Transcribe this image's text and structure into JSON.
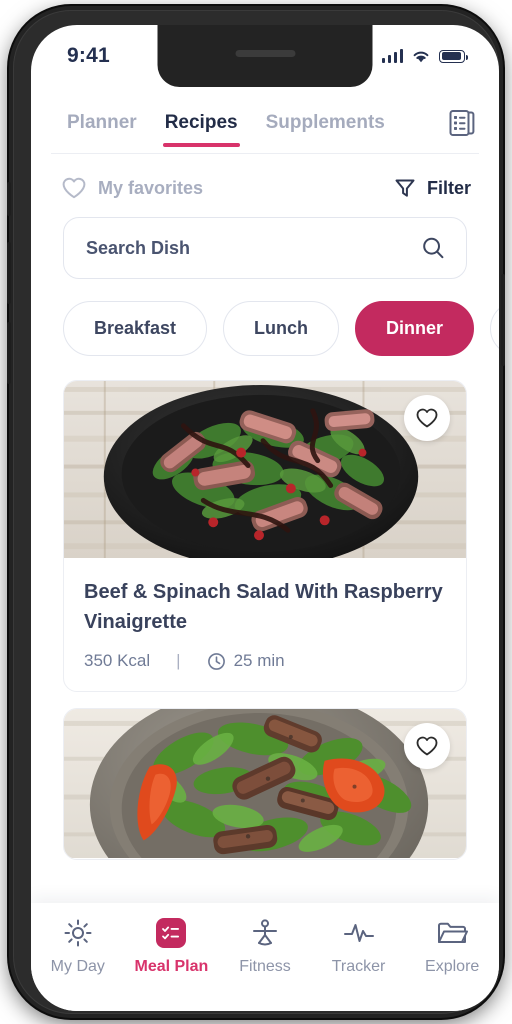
{
  "status_bar": {
    "time": "9:41",
    "signal_icon": "signal-bars-icon",
    "wifi_icon": "wifi-icon",
    "battery_icon": "battery-icon"
  },
  "top_tabs": {
    "items": [
      {
        "label": "Planner",
        "active": false
      },
      {
        "label": "Recipes",
        "active": true
      },
      {
        "label": "Supplements",
        "active": false
      }
    ],
    "document_icon": "document-list-icon",
    "active_indicator_color": "#d8336b"
  },
  "filter_row": {
    "favorites_label": "My favorites",
    "favorites_icon": "heart-icon",
    "filter_label": "Filter",
    "filter_icon": "funnel-icon"
  },
  "search": {
    "placeholder": "Search Dish",
    "value": "",
    "icon": "search-icon"
  },
  "categories": {
    "chips": [
      {
        "label": "Breakfast",
        "active": false
      },
      {
        "label": "Lunch",
        "active": false
      },
      {
        "label": "Dinner",
        "active": true
      },
      {
        "label": "",
        "active": false
      }
    ],
    "active_color": "#c32a5f"
  },
  "recipes": [
    {
      "title": "Beef & Spinach Salad With Raspberry Vinaigrette",
      "calories": "350 Kcal",
      "separator": "|",
      "time": "25 min",
      "time_icon": "clock-icon",
      "favorite_icon": "heart-icon",
      "image_alt": "black plate with sliced beef steak and arugula salad on whitewashed wood"
    },
    {
      "title": "",
      "calories": "",
      "separator": "",
      "time": "",
      "time_icon": "clock-icon",
      "favorite_icon": "heart-icon",
      "image_alt": "rustic grey bowl with arugula, beef strips and roasted red pepper slices"
    }
  ],
  "bottom_nav": {
    "items": [
      {
        "label": "My Day",
        "icon": "sun-icon",
        "active": false
      },
      {
        "label": "Meal Plan",
        "icon": "checklist-icon",
        "active": true
      },
      {
        "label": "Fitness",
        "icon": "yoga-person-icon",
        "active": false
      },
      {
        "label": "Tracker",
        "icon": "pulse-icon",
        "active": false
      },
      {
        "label": "Explore",
        "icon": "folder-icon",
        "active": false
      }
    ],
    "active_color": "#d8336b"
  }
}
